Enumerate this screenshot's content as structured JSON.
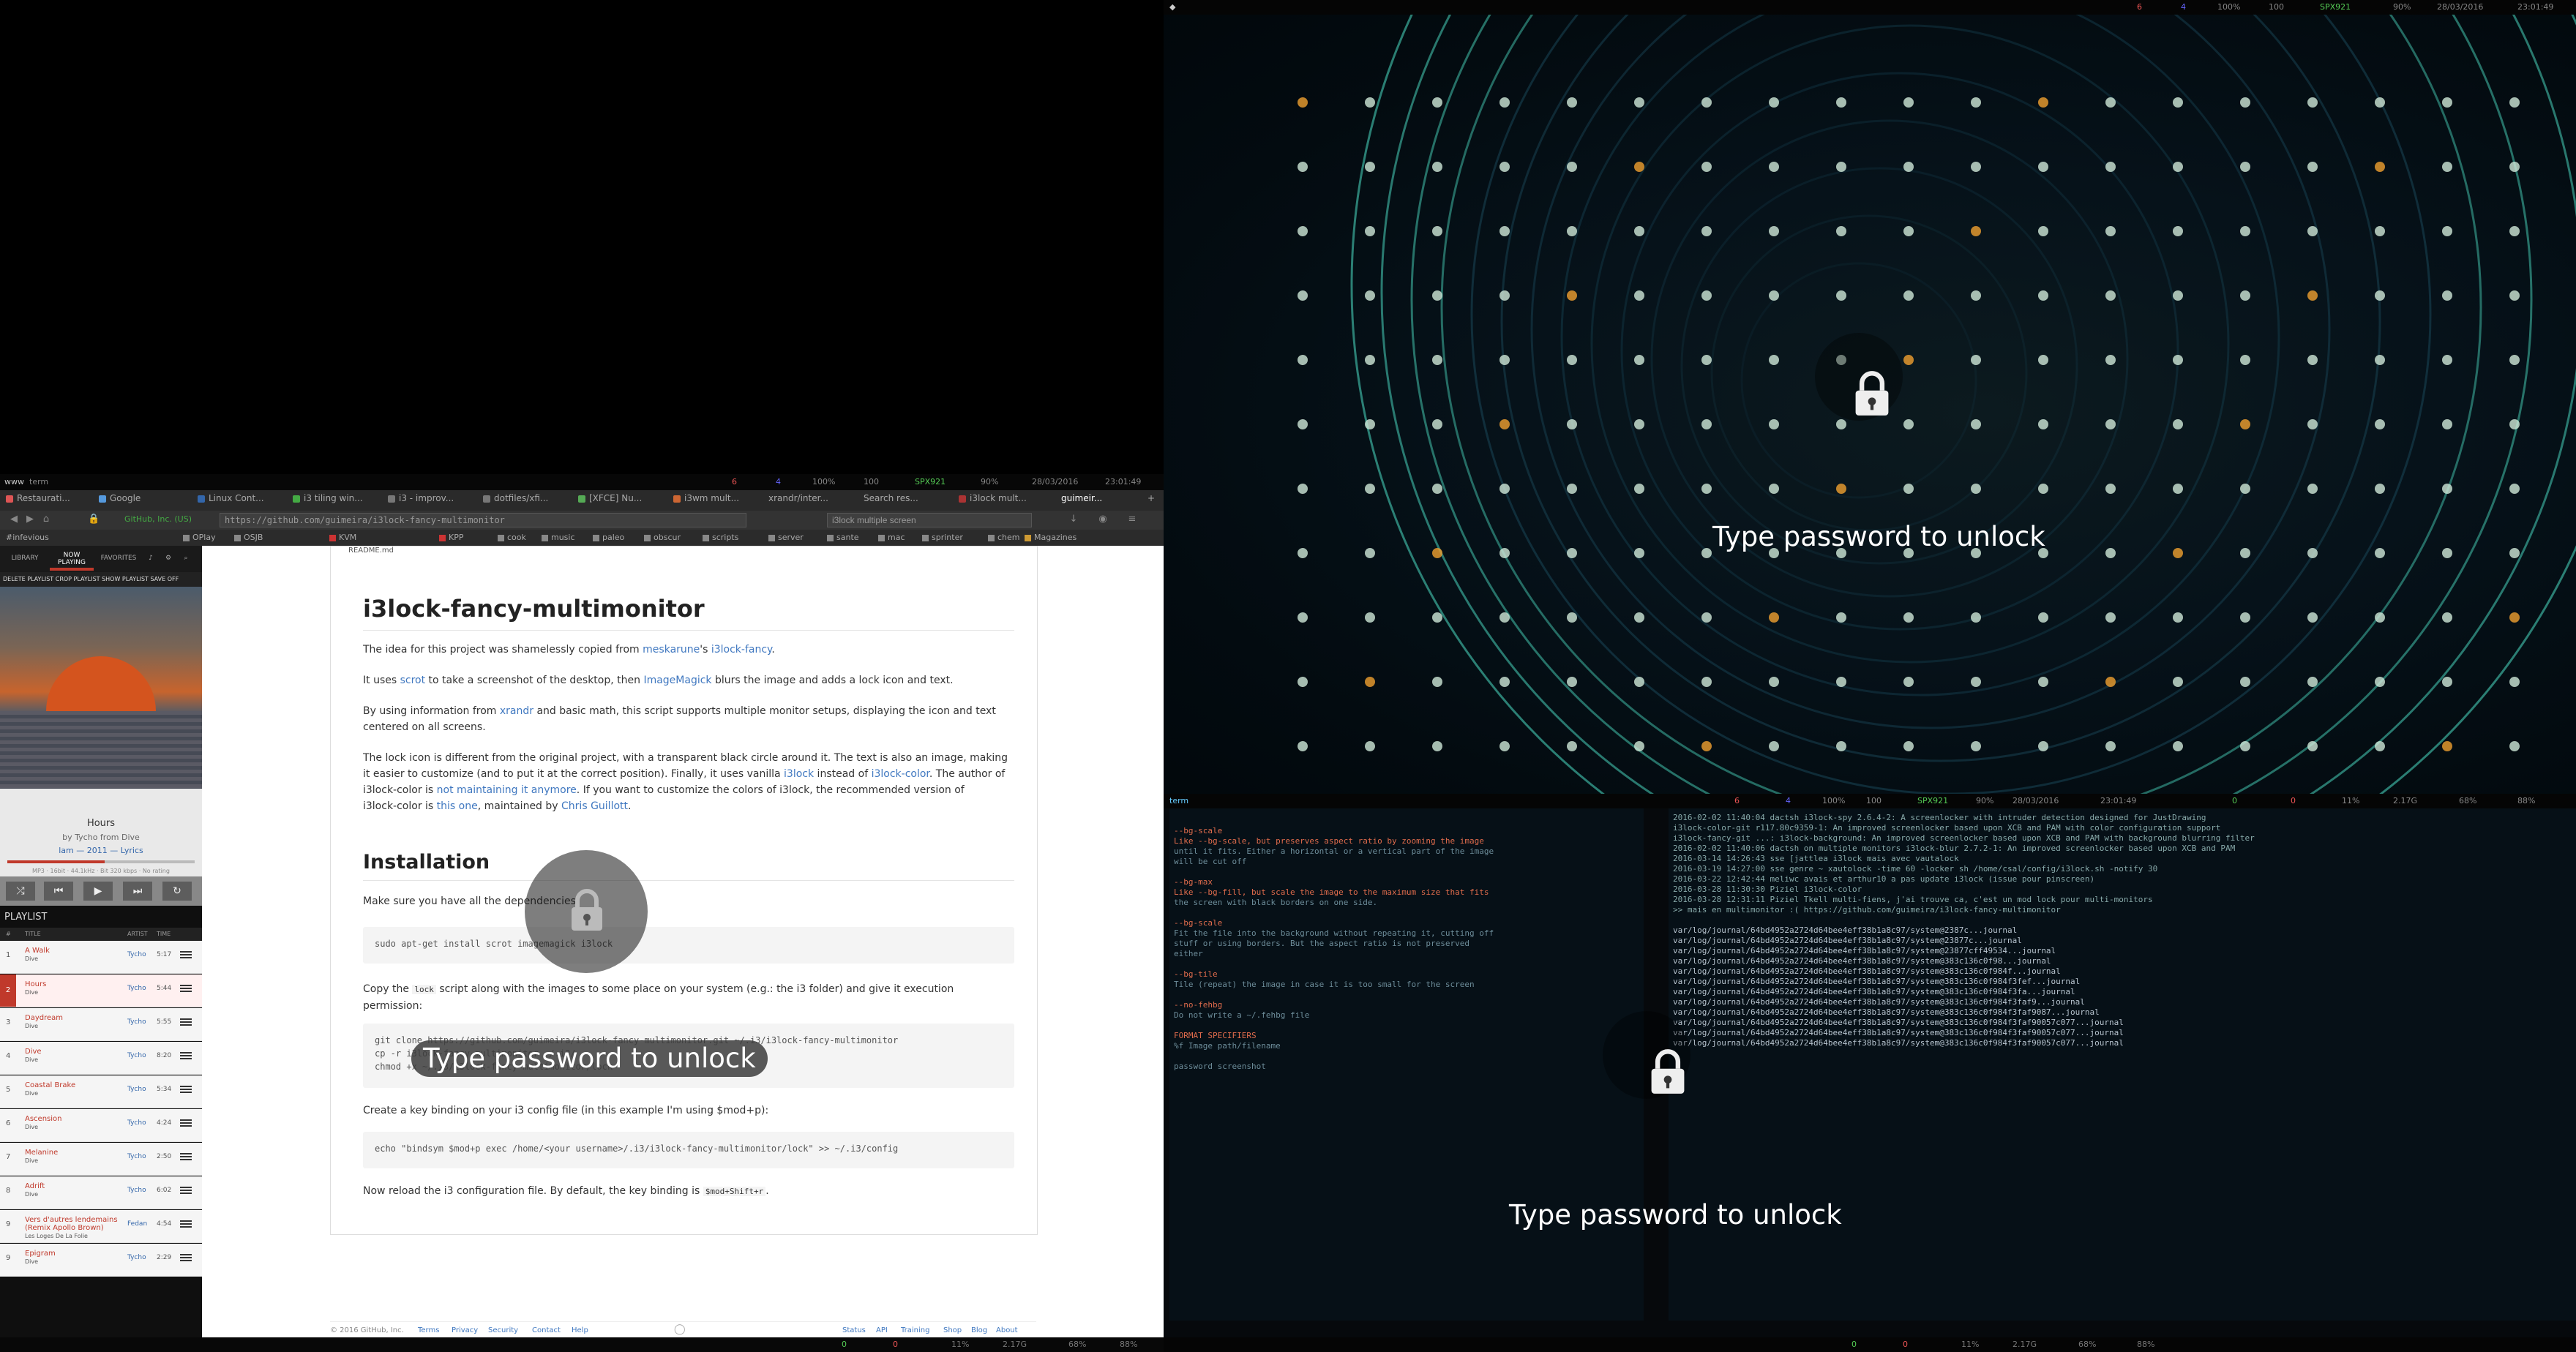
{
  "lock_screen": {
    "prompt": "Type password to unlock"
  },
  "left_monitor": {
    "statusbar": {
      "left_items": [
        "www",
        "term"
      ],
      "right_items": [
        "6",
        "4",
        "100%",
        "100",
        "SPX921",
        "90%",
        "28/03/2016",
        "23:01:49"
      ]
    },
    "browser": {
      "tabs": [
        "Restaurati...",
        "Google",
        "Linux Cont...",
        "i3 tiling win...",
        "i3 - improv...",
        "dotfiles/xfi...",
        "[XFCE] Nu...",
        "i3wm mult...",
        "xrandr/inter...",
        "Search res...",
        "i3lock mult...",
        "guimeir..."
      ],
      "url_ev": "GitHub, Inc. (US)",
      "url": "https://github.com/guimeira/i3lock-fancy-multimonitor",
      "search_placeholder": "i3lock multiple screen",
      "bookmarks": [
        "#infevious",
        "OPlay",
        "OSJB",
        "KVM",
        "KPP",
        "cook",
        "music",
        "paleo",
        "obscur",
        "scripts",
        "server",
        "sante",
        "mac",
        "sprinter",
        "chem",
        "Magazines"
      ]
    },
    "player": {
      "tabs": [
        "LIBRARY",
        "NOW PLAYING",
        "FAVORITES"
      ],
      "action_bar": "DELETE PLAYLIST   CROP PLAYLIST   SHOW PLAYLIST   SAVE OFF",
      "track": {
        "title": "Hours",
        "artist_line": "by Tycho from Dive",
        "sub_line": "lam — 2011 — Lyrics",
        "tech": "MP3 · 16bit · 44.1kHz · Bit 320 kbps · No rating",
        "progress": 0.52
      },
      "controls": [
        "shuffle",
        "prev",
        "play",
        "next",
        "repeat"
      ],
      "playlist_title": "PLAYLIST",
      "playlist_columns": [
        "#",
        "TITLE",
        "ARTIST",
        "TIME"
      ],
      "playlist": [
        {
          "num": "1",
          "title": "A Walk",
          "album": "Dive",
          "artist": "Tycho",
          "time": "5:17"
        },
        {
          "num": "2",
          "title": "Hours",
          "album": "Dive",
          "artist": "Tycho",
          "time": "5:44"
        },
        {
          "num": "3",
          "title": "Daydream",
          "album": "Dive",
          "artist": "Tycho",
          "time": "5:55"
        },
        {
          "num": "4",
          "title": "Dive",
          "album": "Dive",
          "artist": "Tycho",
          "time": "8:20"
        },
        {
          "num": "5",
          "title": "Coastal Brake",
          "album": "Dive",
          "artist": "Tycho",
          "time": "5:34"
        },
        {
          "num": "6",
          "title": "Ascension",
          "album": "Dive",
          "artist": "Tycho",
          "time": "4:24"
        },
        {
          "num": "7",
          "title": "Melanine",
          "album": "Dive",
          "artist": "Tycho",
          "time": "2:50"
        },
        {
          "num": "8",
          "title": "Adrift",
          "album": "Dive",
          "artist": "Tycho",
          "time": "6:02"
        },
        {
          "num": "9",
          "title": "Vers d'autres lendemains (Remix Apollo Brown)",
          "album": "Les Loges De La Folie",
          "artist": "Fedan",
          "time": "4:54"
        },
        {
          "num": "9",
          "title": "Epigram",
          "album": "Dive",
          "artist": "Tycho",
          "time": "2:29"
        }
      ]
    },
    "readme": {
      "label": "README.md",
      "title": "i3lock-fancy-multimonitor",
      "p1": [
        "The idea for this project was shamelessly copied from ",
        "meskarune",
        "'s ",
        "i3lock-fancy",
        "."
      ],
      "p2": [
        "It uses ",
        "scrot",
        " to take a screenshot of the desktop, then ",
        "ImageMagick",
        " blurs the image and adds a lock icon and text."
      ],
      "p3": [
        "By using information from ",
        "xrandr",
        " and basic math, this script supports multiple monitor setups, displaying the icon and text centered on all screens."
      ],
      "p4a": [
        "The lock icon is different from the original project, with a transparent black circle around it. The text is also an image, making it easier to customize (and to put it at the correct position). Finally, it uses vanilla ",
        "i3lock",
        " instead of ",
        "i3lock-color",
        ". The author of"
      ],
      "p4b": [
        "i3lock-color is ",
        "not maintaining it anymore",
        ". If you want to customize the colors of i3lock, the recommended version of"
      ],
      "p4c": [
        "i3lock-color is ",
        "this one",
        ", maintained by ",
        "Chris Guillott",
        "."
      ],
      "h_install": "Installation",
      "p5": "Make sure you have all the dependencies:",
      "code1": "sudo apt-get install scrot imagemagick i3lock",
      "p6a": "Copy the ",
      "p6k": "lock",
      "p6b": " script along with the images to some place on your system (e.g.: the i3 folder) and give it execution permission:",
      "code2": [
        "git clone https://github.com/guimeira/i3lock-fancy-multimonitor.git ~/.i3/i3lock-fancy-multimonitor",
        "cp -r i3lock-fancy-multimonitor ~/.i3/",
        "chmod +x ~/.i3/i3lock-fancy-multimonitor/lock"
      ],
      "p7": "Create a key binding on your i3 config file (in this example I'm using $mod+p):",
      "code3": "echo \"bindsym $mod+p exec /home/<your username>/.i3/i3lock-fancy-multimonitor/lock\" >> ~/.i3/config",
      "p8a": "Now reload the i3 configuration file. By default, the key binding is ",
      "p8k": "$mod+Shift+r",
      "p8b": "."
    },
    "footer": [
      "© 2016 GitHub, Inc.",
      "Terms",
      "Privacy",
      "Security",
      "Contact",
      "Help",
      "Status",
      "API",
      "Training",
      "Shop",
      "Blog",
      "About"
    ],
    "bottombar": [
      "0",
      "0",
      "11%",
      "2.17G",
      "68%",
      "88%"
    ]
  },
  "right_top_monitor": {
    "statusbar": [
      "6",
      "4",
      "100%",
      "100",
      "SPX921",
      "90%",
      "28/03/2016",
      "23:01:49"
    ]
  },
  "right_bottom_monitor": {
    "statusbar": [
      "6",
      "4",
      "100%",
      "100",
      "SPX921",
      "90%",
      "28/03/2016",
      "23:01:49"
    ],
    "status_right": [
      "0",
      "0",
      "11%",
      "2.17G",
      "68%",
      "88%"
    ],
    "term_title": "term",
    "term_left_lines": [
      "       --bg-scale",
      "              Like --bg-scale, but preserves aspect ratio by zooming the image",
      "              until it fits.  Either a horizontal or a vertical part of the image",
      "              will be cut off",
      "",
      "       --bg-max",
      "              Like --bg-fill, but scale the image to the maximum size that fits",
      "              the screen with black borders on one side.",
      "",
      "       --bg-scale",
      "              Fit the file into the background without repeating it, cutting off",
      "              stuff or using borders.  But the aspect ratio is not preserved",
      "              either",
      "",
      "       --bg-tile",
      "              Tile (repeat) the image in case it is too small for the screen",
      "",
      "       --no-fehbg",
      "              Do not write a ~/.fehbg file",
      "",
      "FORMAT SPECIFIERS",
      "       %f      Image path/filename",
      "",
      "password   screenshot"
    ],
    "term_right_lines": [
      "2016-02-02 11:40:04    dactsh  i3lock-spy 2.6.4-2: A screenlocker with intruder detection designed for JustDrawing",
      "i3lock-color-git r117.80c9359-1: An improved screenlocker based upon XCB and PAM with color configuration support",
      "i3lock-fancy-git ...: i3lock-background: An improved screenlocker based upon XCB and PAM with background blurring filter",
      "2016-02-02 11:40:06    dactsh  on multiple monitors   i3lock-blur 2.7.2-1: An improved screenlocker based upon XCB and PAM",
      "2016-03-14 14:26:43    sse     [jattlea i3lock mais avec vautalock",
      "2016-03-19 14:27:00    sse     genre ~ xautolock -time 60 -locker sh /home/csal/config/i3lock.sh -notify 30",
      "2016-03-22 12:42:44    meliwc  avais et arthur10 a pas update i3lock (issue pour pinscreen)",
      "2016-03-28 11:30:30    Piziel  i3lock-color",
      "2016-03-28 12:31:11    Piziel  Tkell multi-fiens, j'ai trouve ca, c'est un mod lock pour multi-monitors",
      ">> mais en multimonitor :( https://github.com/guimeira/i3lock-fancy-multimonitor",
      "",
      "var/log/journal/64bd4952a2724d64bee4eff38b1a8c97/system@2387c...journal",
      "var/log/journal/64bd4952a2724d64bee4eff38b1a8c97/system@23877c...journal",
      "var/log/journal/64bd4952a2724d64bee4eff38b1a8c97/system@23877cff49534...journal",
      "var/log/journal/64bd4952a2724d64bee4eff38b1a8c97/system@383c136c0f98...journal",
      "var/log/journal/64bd4952a2724d64bee4eff38b1a8c97/system@383c136c0f984f...journal",
      "var/log/journal/64bd4952a2724d64bee4eff38b1a8c97/system@383c136c0f984f3fef...journal",
      "var/log/journal/64bd4952a2724d64bee4eff38b1a8c97/system@383c136c0f984f3fa...journal",
      "var/log/journal/64bd4952a2724d64bee4eff38b1a8c97/system@383c136c0f984f3faf9...journal",
      "var/log/journal/64bd4952a2724d64bee4eff38b1a8c97/system@383c136c0f984f3faf9087...journal",
      "var/log/journal/64bd4952a2724d64bee4eff38b1a8c97/system@383c136c0f984f3faf90057c077...journal",
      "var/log/journal/64bd4952a2724d64bee4eff38b1a8c97/system@383c136c0f984f3faf90057c077...journal",
      "var/log/journal/64bd4952a2724d64bee4eff38b1a8c97/system@383c136c0f984f3faf90057c077...journal"
    ],
    "bottombar": [
      "0",
      "0",
      "11%",
      "2.17G",
      "68%",
      "88%"
    ]
  },
  "colors": {
    "accent_red": "#c0392b",
    "link_blue": "#4078c0",
    "lock_text": "#ffffff"
  }
}
